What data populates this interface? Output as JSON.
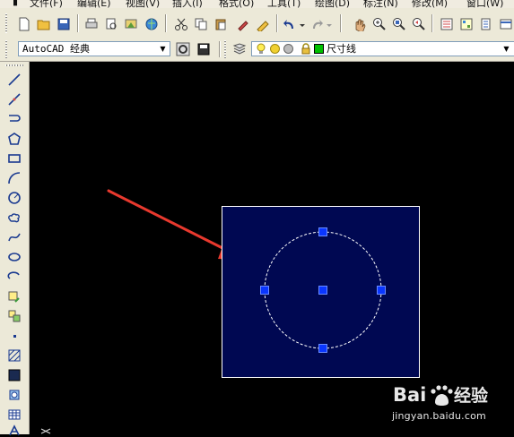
{
  "menu": {
    "items": [
      {
        "label": "文件(F)"
      },
      {
        "label": "编辑(E)"
      },
      {
        "label": "视图(V)"
      },
      {
        "label": "插入(I)"
      },
      {
        "label": "格式(O)"
      },
      {
        "label": "工具(T)"
      },
      {
        "label": "绘图(D)"
      },
      {
        "label": "标注(N)"
      },
      {
        "label": "修改(M)"
      },
      {
        "label": "窗口(W)"
      }
    ]
  },
  "workspace": {
    "value": "AutoCAD 经典"
  },
  "layer": {
    "value": "尺寸线",
    "color": "#00c000"
  },
  "colors": {
    "background": "#000000",
    "selection_fill": "#000852",
    "grip": "#0a36ff",
    "arrow": "#e8392e",
    "toolbar": "#ece9d8"
  },
  "watermark": {
    "logo_text": "Baidu经验",
    "url": "jingyan.baidu.com"
  }
}
